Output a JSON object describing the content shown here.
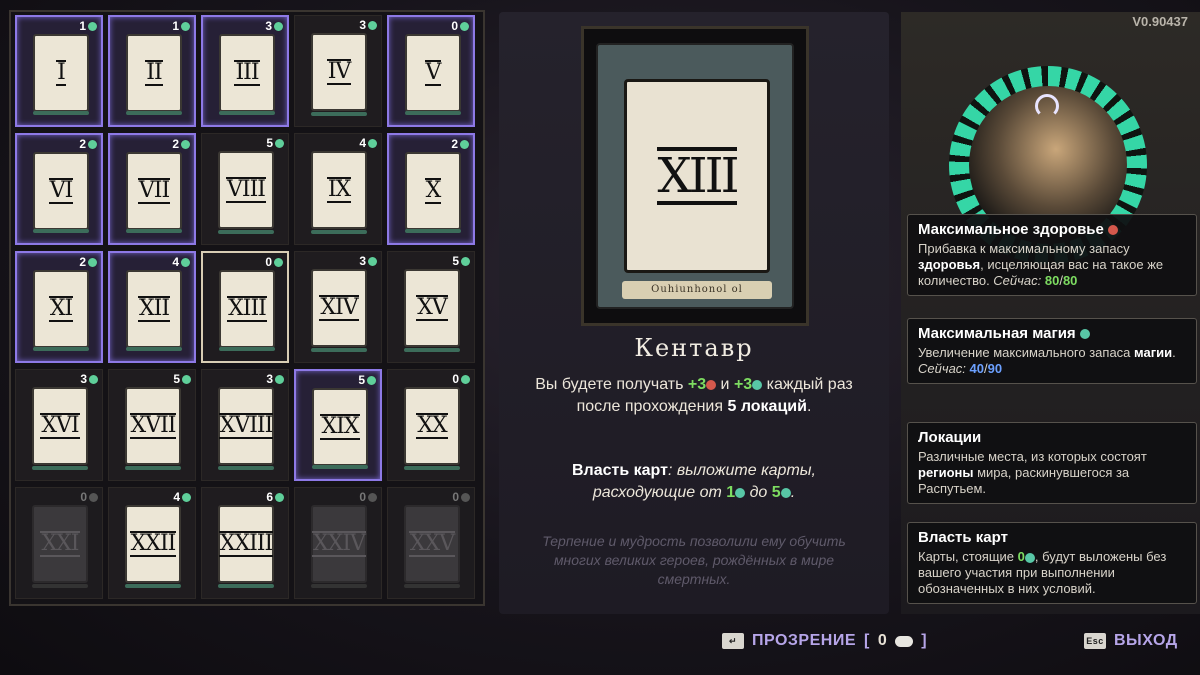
{
  "version": "V0.90437",
  "cards": [
    {
      "numeral": "I",
      "cost": "1",
      "state": "upgraded"
    },
    {
      "numeral": "II",
      "cost": "1",
      "state": "upgraded"
    },
    {
      "numeral": "III",
      "cost": "3",
      "state": "upgraded"
    },
    {
      "numeral": "IV",
      "cost": "3",
      "state": "normal"
    },
    {
      "numeral": "V",
      "cost": "0",
      "state": "upgraded"
    },
    {
      "numeral": "VI",
      "cost": "2",
      "state": "upgraded"
    },
    {
      "numeral": "VII",
      "cost": "2",
      "state": "upgraded"
    },
    {
      "numeral": "VIII",
      "cost": "5",
      "state": "normal"
    },
    {
      "numeral": "IX",
      "cost": "4",
      "state": "normal"
    },
    {
      "numeral": "X",
      "cost": "2",
      "state": "upgraded"
    },
    {
      "numeral": "XI",
      "cost": "2",
      "state": "upgraded"
    },
    {
      "numeral": "XII",
      "cost": "4",
      "state": "upgraded"
    },
    {
      "numeral": "XIII",
      "cost": "0",
      "state": "selected"
    },
    {
      "numeral": "XIV",
      "cost": "3",
      "state": "normal"
    },
    {
      "numeral": "XV",
      "cost": "5",
      "state": "normal"
    },
    {
      "numeral": "XVI",
      "cost": "3",
      "state": "normal"
    },
    {
      "numeral": "XVII",
      "cost": "5",
      "state": "normal"
    },
    {
      "numeral": "XVIII",
      "cost": "3",
      "state": "normal"
    },
    {
      "numeral": "XIX",
      "cost": "5",
      "state": "upgraded"
    },
    {
      "numeral": "XX",
      "cost": "0",
      "state": "normal"
    },
    {
      "numeral": "XXI",
      "cost": "0",
      "state": "locked"
    },
    {
      "numeral": "XXII",
      "cost": "4",
      "state": "normal"
    },
    {
      "numeral": "XXIII",
      "cost": "6",
      "state": "normal"
    },
    {
      "numeral": "XXIV",
      "cost": "0",
      "state": "locked"
    },
    {
      "numeral": "XXV",
      "cost": "0",
      "state": "locked"
    }
  ],
  "detail": {
    "numeral": "XIII",
    "label": "Ouhiunhonol ol",
    "name": "Кентавр",
    "desc": {
      "part1": "Вы будете получать ",
      "health_gain": "+3",
      "part2": " и ",
      "magic_gain": "+3",
      "part3": " каждый раз после прохождения ",
      "locations": "5 локаций",
      "part4": "."
    },
    "power": {
      "title": "Власть карт",
      "part1": ": выложите карты, расходующие от ",
      "from": "1",
      "part2": " до ",
      "to": "5",
      "part3": "."
    },
    "flavor": "Терпение и мудрость позволили ему обучить многих великих героев, рождённых в мире смертных."
  },
  "tooltips": {
    "health": {
      "title": "Максимальное здоровье",
      "body1": "Прибавка к максимальному запасу ",
      "bold1": "здоровья",
      "body2": ", исцеляющая вас на такое же количество. ",
      "now": "Сейчас:",
      "current": "80",
      "sep": "/",
      "max": "80"
    },
    "magic": {
      "title": "Максимальная магия",
      "body1": "Увеличение максимального запаса ",
      "bold1": "магии",
      "body2": ". ",
      "now": "Сейчас:",
      "current": "40",
      "sep": "/",
      "max": "90"
    },
    "locations": {
      "title": "Локации",
      "body1": "Различные места, из которых состоят ",
      "bold1": "регионы",
      "body2": " мира, раскинувшегося за Распутьем."
    },
    "power": {
      "title": "Власть карт",
      "body1": "Карты, стоящие ",
      "zero": "0",
      "body2": ", будут выложены без вашего участия при выполнении обозначенных в них условий."
    }
  },
  "bottom": {
    "insight_key": "↵",
    "insight_label": "ПРОЗРЕНИЕ",
    "insight_open": "[",
    "insight_count": "0",
    "insight_close": "]",
    "exit_key": "Esc",
    "exit_label": "ВЫХОД"
  },
  "colors": {
    "accent_purple": "#b6a5e8",
    "health_green": "#7ddc61",
    "magic_blue": "#6ca0ff",
    "ring_teal": "#35d6a6"
  }
}
